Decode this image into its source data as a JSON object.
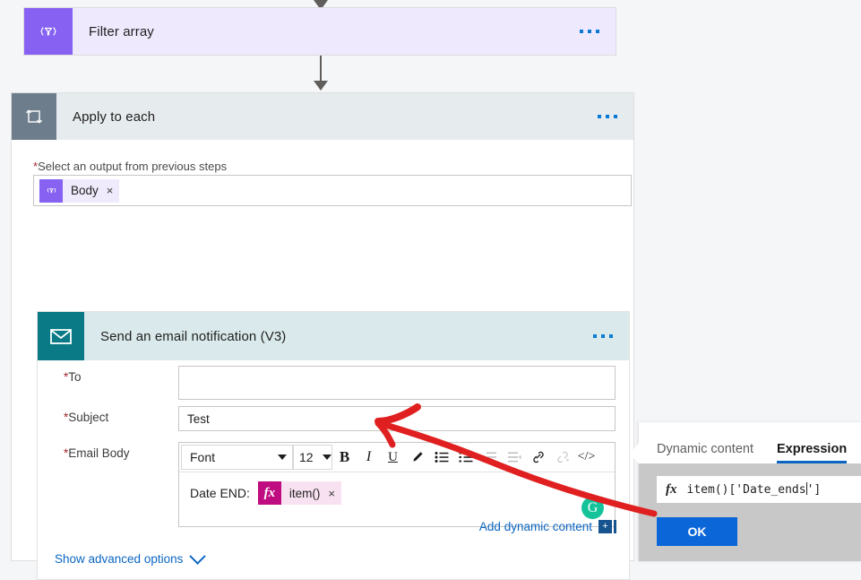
{
  "flow": {
    "filter_array": {
      "title": "Filter array",
      "icon": "filter-array-icon",
      "icon_color": "#8661f2",
      "bg_color": "#eee9fd",
      "menu": "more-options"
    },
    "apply_to_each": {
      "title": "Apply to each",
      "icon": "loop-icon",
      "icon_color": "#6d7d8c",
      "header_bg": "#e6ebee",
      "menu": "more-options",
      "output_field": {
        "label": "Select an output from previous steps",
        "required": true,
        "token": {
          "icon": "filter-array-icon",
          "text": "Body",
          "remove": "×",
          "icon_color": "#8661f2",
          "chip_color": "#efeafc"
        }
      }
    },
    "email_action": {
      "title": "Send an email notification (V3)",
      "icon": "envelope-icon",
      "icon_color": "#0a7b86",
      "header_bg": "#daeaec",
      "menu": "more-options",
      "fields": {
        "to": {
          "label": "To",
          "required": true,
          "value": "",
          "placeholder": ""
        },
        "subject": {
          "label": "Subject",
          "required": true,
          "value": "Test",
          "placeholder": ""
        },
        "email_body": {
          "label": "Email Body",
          "required": true
        }
      },
      "toolbar": {
        "font_label": "Font",
        "size_label": "12",
        "buttons": [
          {
            "name": "bold-icon",
            "glyph": "B",
            "enabled": true
          },
          {
            "name": "italic-icon",
            "glyph": "I",
            "enabled": true
          },
          {
            "name": "underline-icon",
            "glyph": "U",
            "enabled": true
          },
          {
            "name": "highlight-pen-icon",
            "glyph": "✐",
            "enabled": true
          },
          {
            "name": "bulleted-list-icon",
            "glyph": "☰",
            "enabled": true
          },
          {
            "name": "numbered-list-icon",
            "glyph": "≡",
            "enabled": true
          },
          {
            "name": "indent-icon",
            "glyph": "⇥",
            "enabled": false
          },
          {
            "name": "outdent-icon",
            "glyph": "⇤",
            "enabled": false
          },
          {
            "name": "link-icon",
            "glyph": "🔗",
            "enabled": true
          },
          {
            "name": "unlink-icon",
            "glyph": "🔗",
            "enabled": false
          },
          {
            "name": "code-view-icon",
            "glyph": "</>",
            "enabled": true
          }
        ]
      },
      "body_content": {
        "text": "Date END:",
        "token": {
          "icon": "fx-icon",
          "icon_text": "fx",
          "text": "item()",
          "remove": "×",
          "icon_color": "#bf0c80",
          "chip_color": "#f8e2f1"
        },
        "grammarly_badge": "G"
      },
      "add_dynamic_content": "Add dynamic content",
      "add_dynamic_plus": "+",
      "show_advanced_options": "Show advanced options"
    }
  },
  "expression_panel": {
    "tabs": [
      {
        "label": "Dynamic content",
        "active": false
      },
      {
        "label": "Expression",
        "active": true
      }
    ],
    "fx_label": "fx",
    "expression_value": "item()['Date_ends']",
    "cursor_after": "item()['Date_ends",
    "cursor_tail": "']",
    "ok_label": "OK",
    "accent_color": "#0b66d8"
  },
  "annotation": {
    "type": "red-arrow",
    "color": "#e02020",
    "points_to": "email-body-editor"
  }
}
